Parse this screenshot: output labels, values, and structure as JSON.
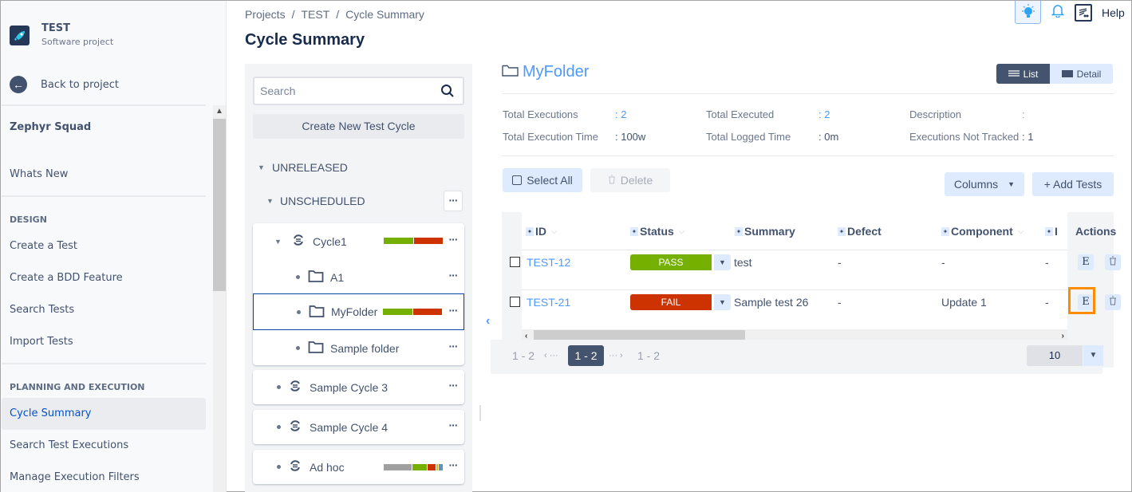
{
  "sidebar": {
    "project_name": "TEST",
    "project_type": "Software project",
    "back_label": "Back to project",
    "app_title": "Zephyr Squad",
    "whats_new": "Whats New",
    "design_heading": "DESIGN",
    "design_items": [
      "Create a Test",
      "Create a BDD Feature",
      "Search Tests",
      "Import Tests"
    ],
    "planning_heading": "PLANNING AND EXECUTION",
    "planning_items": [
      "Cycle Summary",
      "Search Test Executions",
      "Manage Execution Filters"
    ],
    "active_item": "Cycle Summary"
  },
  "header": {
    "breadcrumb": [
      "Projects",
      "TEST",
      "Cycle Summary"
    ],
    "breadcrumb_sep": "/",
    "title": "Cycle Summary",
    "help_label": "Help"
  },
  "tree": {
    "search_placeholder": "Search",
    "create_label": "Create New Test Cycle",
    "version": "UNRELEASED",
    "schedule": "UNSCHEDULED",
    "more_label": "···",
    "cycles": [
      {
        "name": "Cycle1",
        "expanded": true,
        "progress": [
          {
            "status": "PASS",
            "fraction": 0.5,
            "color": "#75b000"
          },
          {
            "status": "FAIL",
            "fraction": 0.5,
            "color": "#cc3300"
          }
        ],
        "folders": [
          {
            "name": "A1"
          },
          {
            "name": "MyFolder",
            "selected": true,
            "progress": [
              {
                "status": "PASS",
                "fraction": 0.5,
                "color": "#75b000"
              },
              {
                "status": "FAIL",
                "fraction": 0.5,
                "color": "#cc3300"
              }
            ]
          },
          {
            "name": "Sample folder"
          }
        ]
      },
      {
        "name": "Sample Cycle 3"
      },
      {
        "name": "Sample Cycle 4"
      },
      {
        "name": "Ad hoc",
        "progress": [
          {
            "status": "UNEXECUTED",
            "fraction": 0.5,
            "color": "#a0a0a0"
          },
          {
            "status": "PASS",
            "fraction": 0.25,
            "color": "#75b000"
          },
          {
            "status": "FAIL",
            "fraction": 0.15,
            "color": "#cc3300"
          },
          {
            "status": "WIP",
            "fraction": 0.03,
            "color": "#f2b000"
          },
          {
            "status": "BLOCKED",
            "fraction": 0.07,
            "color": "#6693b0"
          }
        ]
      }
    ]
  },
  "main": {
    "folder_title": "MyFolder",
    "view_list": "List",
    "view_detail": "Detail",
    "stats": {
      "total_executions_label": "Total Executions",
      "total_executions": ": 2",
      "total_executed_label": "Total Executed",
      "total_executed": ": 2",
      "description_label": "Description",
      "description": ":",
      "total_exec_time_label": "Total Execution Time",
      "total_exec_time": ": 100w",
      "total_logged_label": "Total Logged Time",
      "total_logged": ": 0m",
      "not_tracked_label": "Executions Not Tracked",
      "not_tracked": ": 1"
    },
    "select_all": "Select All",
    "delete": "Delete",
    "columns": "Columns",
    "add_tests": "+ Add Tests",
    "table": {
      "headers": [
        "ID",
        "Status",
        "Summary",
        "Defect",
        "Component",
        "I",
        "Actions"
      ],
      "rows": [
        {
          "id": "TEST-12",
          "status": "PASS",
          "status_color": "#75b000",
          "summary": "test",
          "defect": "-",
          "component": "-",
          "extra": "-",
          "edit": "E"
        },
        {
          "id": "TEST-21",
          "status": "FAIL",
          "status_color": "#cc3300",
          "summary": "Sample test 26",
          "defect": "-",
          "component": "Update 1",
          "extra": "-",
          "edit": "E"
        }
      ]
    },
    "pager": {
      "first": "1 - 2",
      "prev": "‹ ···",
      "current": "1 - 2",
      "next": "··· ›",
      "last": "1 - 2",
      "page_size": "10"
    }
  }
}
